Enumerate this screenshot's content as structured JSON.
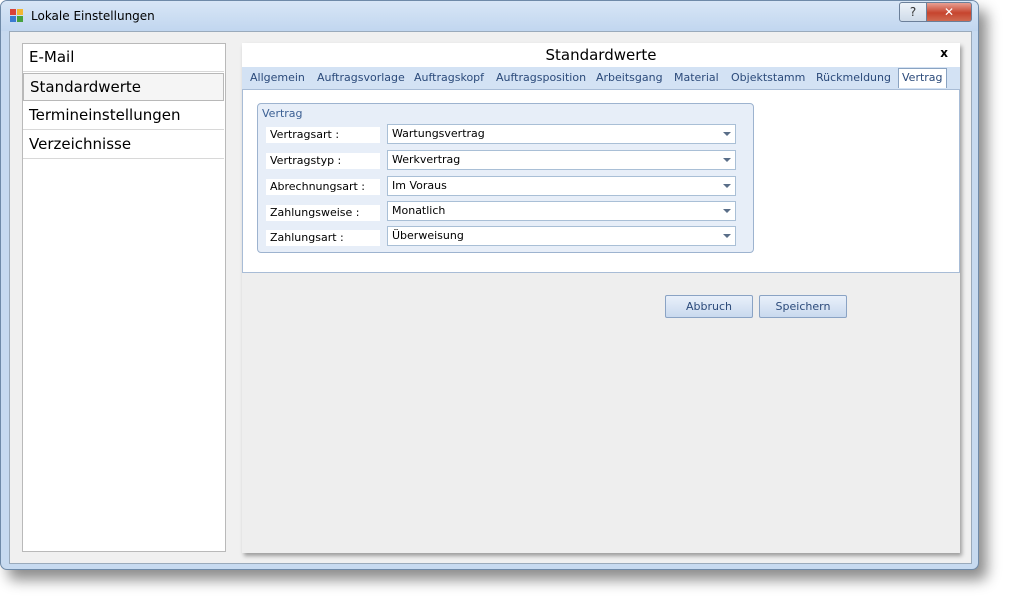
{
  "window": {
    "title": "Lokale Einstellungen",
    "help_glyph": "?",
    "close_glyph": "✕"
  },
  "nav": {
    "items": [
      "E-Mail",
      "Standardwerte",
      "Termineinstellungen",
      "Verzeichnisse"
    ],
    "selected": "Standardwerte"
  },
  "panel": {
    "title": "Standardwerte",
    "close_glyph": "x",
    "tabs": [
      "Allgemein",
      "Auftragsvorlage",
      "Auftragskopf",
      "Auftragsposition",
      "Arbeitsgang",
      "Material",
      "Objektstamm",
      "Rückmeldung",
      "Vertrag"
    ],
    "active_tab": "Vertrag",
    "group": {
      "title": "Vertrag",
      "fields": [
        {
          "label": "Vertragsart :",
          "value": "Wartungsvertrag"
        },
        {
          "label": "Vertragstyp :",
          "value": "Werkvertrag"
        },
        {
          "label": "Abrechnungsart :",
          "value": "Im Voraus"
        },
        {
          "label": "Zahlungsweise :",
          "value": "Monatlich"
        },
        {
          "label": "Zahlungsart :",
          "value": "Überweisung"
        }
      ]
    }
  },
  "buttons": {
    "cancel": "Abbruch",
    "save": "Speichern"
  },
  "colors": {
    "accent": "#2b4a7a",
    "tab_strip": "#d3e2f4",
    "group_bg": "#e7eef8",
    "close_red": "#c6442e"
  }
}
